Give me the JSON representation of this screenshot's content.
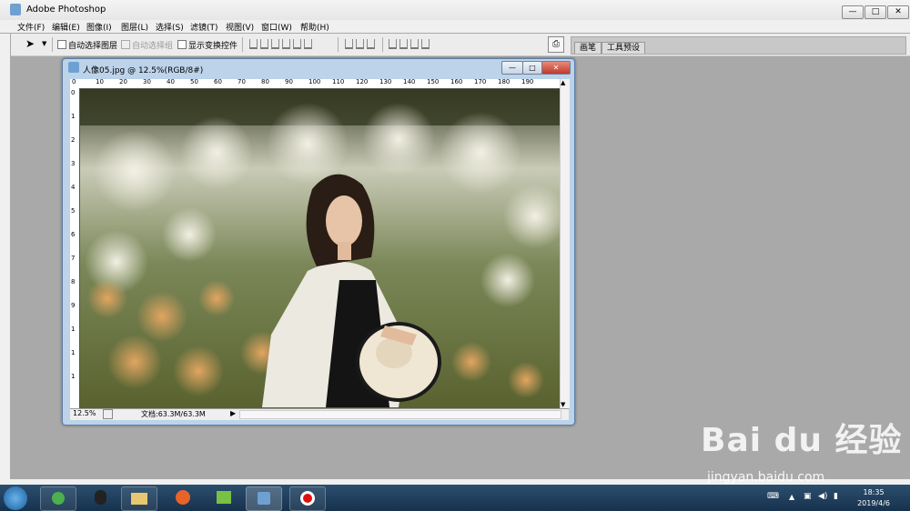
{
  "app": {
    "title": "Adobe Photoshop",
    "window_buttons": {
      "minimize": "—",
      "maximize": "□",
      "close": "✕"
    }
  },
  "menu": [
    "文件(F)",
    "编辑(E)",
    "图像(I)",
    "图层(L)",
    "选择(S)",
    "滤镜(T)",
    "视图(V)",
    "窗口(W)",
    "帮助(H)"
  ],
  "options": {
    "auto_select_layer": "自动选择图层",
    "auto_select_group": "自动选择组",
    "show_transform": "显示变换控件"
  },
  "palette_well": {
    "tabs": [
      "画笔",
      "工具预设"
    ]
  },
  "document": {
    "title": "人像05.jpg @ 12.5%(RGB/8#)",
    "zoom": "12.5%",
    "doc_size": "文档:63.3M/63.3M",
    "ruler_top": [
      "0",
      "10",
      "20",
      "30",
      "40",
      "50",
      "60",
      "70",
      "80",
      "90",
      "100",
      "110",
      "120",
      "130",
      "140",
      "150",
      "160",
      "170",
      "180",
      "190"
    ],
    "ruler_left": [
      "0",
      "1 0",
      "2 0",
      "3 0",
      "4 0",
      "5 0",
      "6 0",
      "7 0",
      "8 0",
      "9 0",
      "1 0 0",
      "1 1 0",
      "1 2 0"
    ]
  },
  "taskbar": {
    "apps": [
      "start-icon",
      "360-browser-icon",
      "qq-icon",
      "file-explorer-icon",
      "firefox-icon",
      "video-editor-icon",
      "photoshop-icon",
      "recorder-icon"
    ],
    "time": "18:35",
    "date": "2019/4/6"
  },
  "watermark": {
    "brand": "Bai du 经验",
    "url": "jingyan.baidu.com"
  }
}
